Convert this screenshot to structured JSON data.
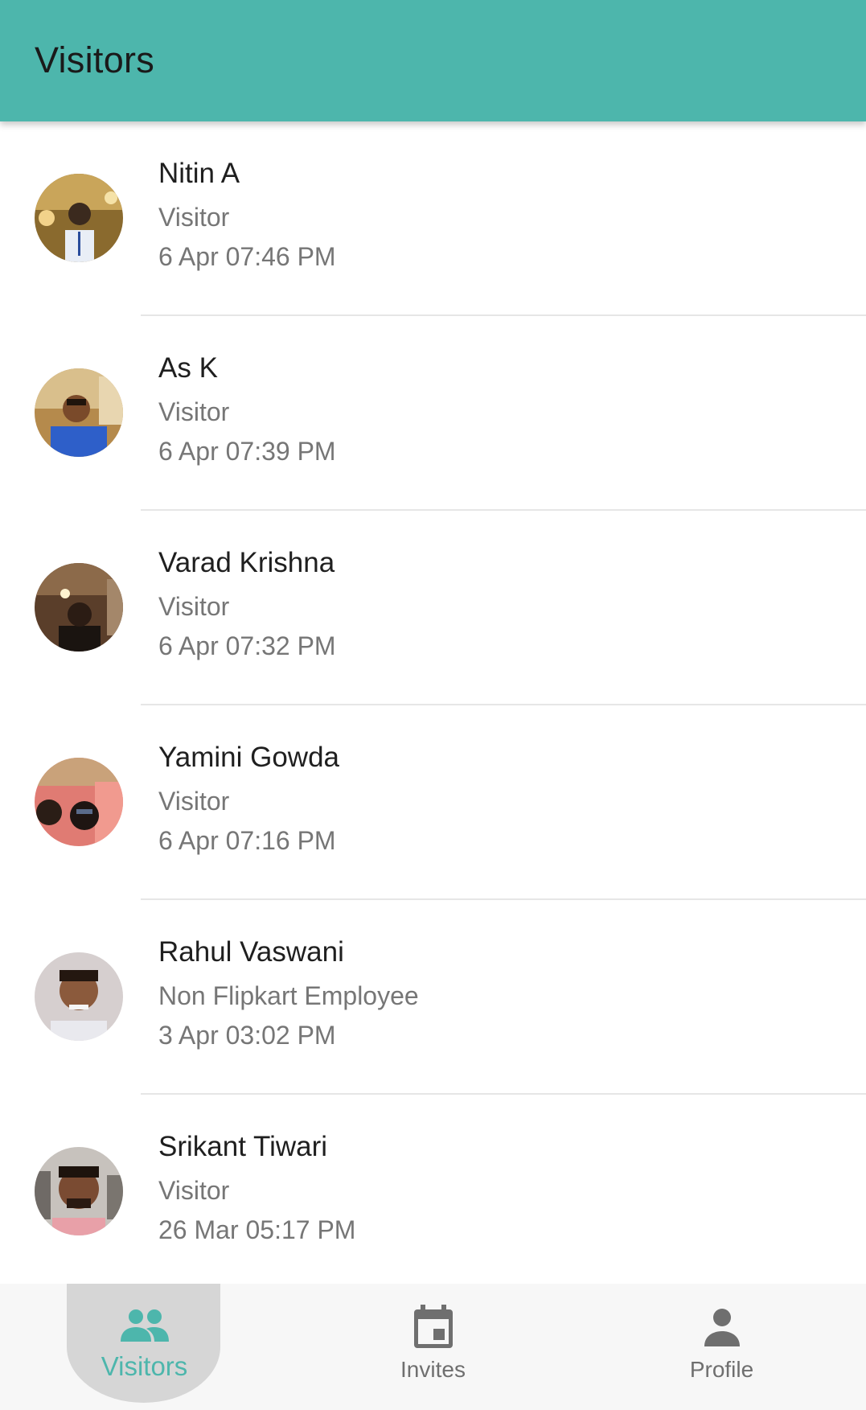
{
  "app_bar": {
    "title": "Visitors",
    "color": "#4DB6AC"
  },
  "visitors": [
    {
      "name": "Nitin A",
      "type": "Visitor",
      "time": "6 Apr 07:46 PM"
    },
    {
      "name": "As K",
      "type": "Visitor",
      "time": "6 Apr 07:39 PM"
    },
    {
      "name": "Varad Krishna",
      "type": "Visitor",
      "time": "6 Apr 07:32 PM"
    },
    {
      "name": "Yamini Gowda",
      "type": "Visitor",
      "time": "6 Apr 07:16 PM"
    },
    {
      "name": "Rahul Vaswani",
      "type": "Non Flipkart Employee",
      "time": "3 Apr 03:02 PM"
    },
    {
      "name": "Srikant Tiwari",
      "type": "Visitor",
      "time": "26 Mar 05:17 PM"
    }
  ],
  "bottom_nav": {
    "items": [
      {
        "label": "Visitors",
        "icon": "people-icon",
        "active": true
      },
      {
        "label": "Invites",
        "icon": "calendar-event-icon",
        "active": false
      },
      {
        "label": "Profile",
        "icon": "person-icon",
        "active": false
      }
    ],
    "active_color": "#4DB6AC",
    "inactive_color": "#6f6f6f"
  }
}
